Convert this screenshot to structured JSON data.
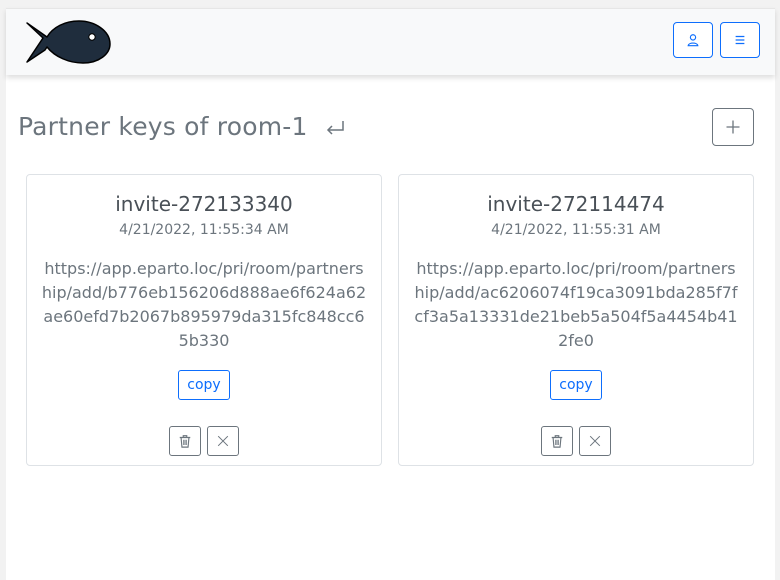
{
  "header": {
    "logo_icon": "fish-logo-icon",
    "user_icon": "person-icon",
    "menu_icon": "hamburger-menu-icon"
  },
  "main": {
    "title": "Partner keys of room-1",
    "back_icon": "return-arrow-icon",
    "add_icon": "plus-icon"
  },
  "cards": [
    {
      "name": "invite-272133340",
      "date": "4/21/2022, 11:55:34 AM",
      "url": "https://app.eparto.loc/pri/room/partnership/add/b776eb156206d888ae6f624a62ae60efd7b2067b895979da315fc848cc65b330",
      "copy_label": "copy",
      "delete_icon": "trash-icon",
      "close_icon": "x-icon"
    },
    {
      "name": "invite-272114474",
      "date": "4/21/2022, 11:55:31 AM",
      "url": "https://app.eparto.loc/pri/room/partnership/add/ac6206074f19ca3091bda285f7fcf3a5a13331de21beb5a504f5a4454b412fe0",
      "copy_label": "copy",
      "delete_icon": "trash-icon",
      "close_icon": "x-icon"
    }
  ],
  "colors": {
    "primary": "#0d6efd",
    "secondary": "#6c757d",
    "logo_fill": "#1f2d3d"
  }
}
